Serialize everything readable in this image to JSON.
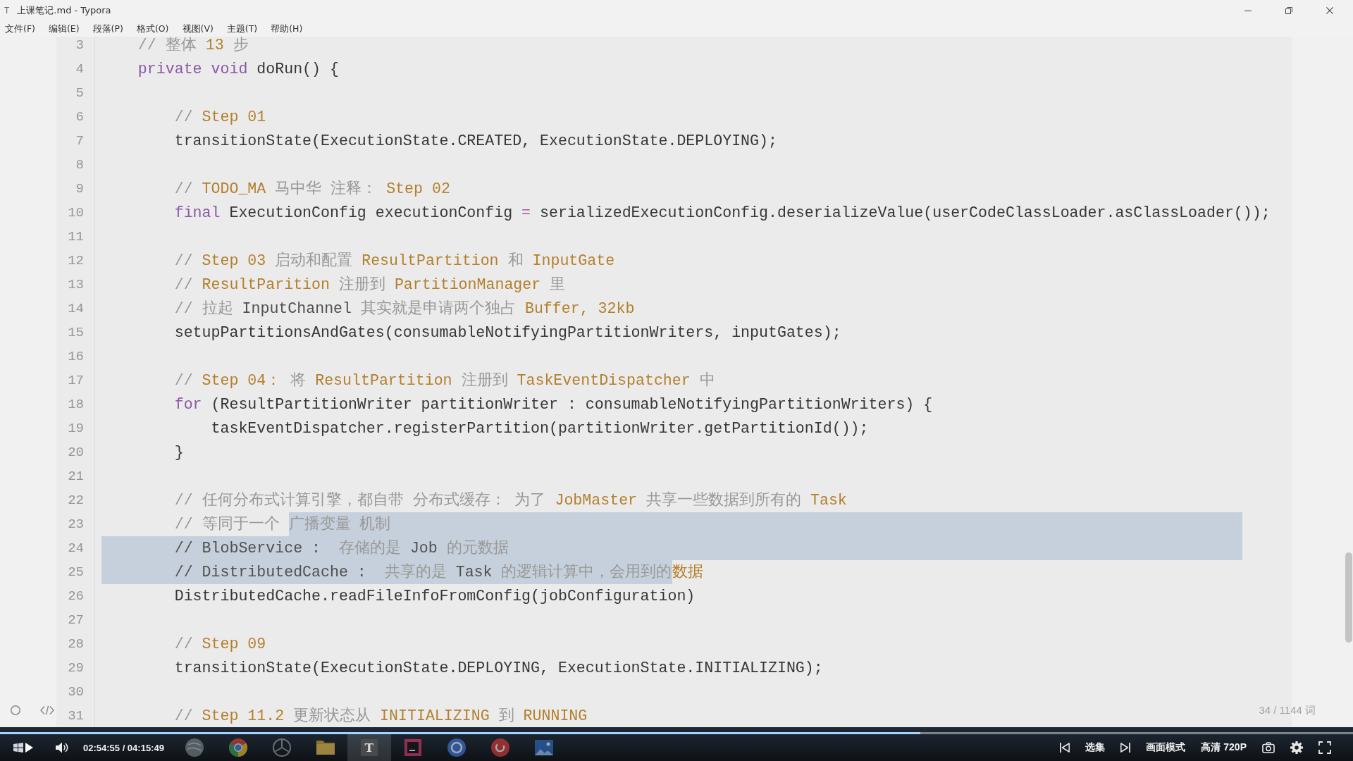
{
  "window": {
    "app_letter": "T",
    "title": "上课笔记.md - Typora"
  },
  "menu": [
    "文件(F)",
    "编辑(E)",
    "段落(P)",
    "格式(O)",
    "视图(V)",
    "主题(T)",
    "帮助(H)"
  ],
  "editor": {
    "lines": [
      {
        "number": "3",
        "eol_selected": false,
        "segments": [
          {
            "selected": false,
            "tokens": [
              {
                "text": "    // 整体 ",
                "kind": "comment"
              },
              {
                "text": "13",
                "kind": "term"
              },
              {
                "text": " 步",
                "kind": "comment"
              }
            ]
          }
        ]
      },
      {
        "number": "4",
        "eol_selected": false,
        "segments": [
          {
            "selected": false,
            "tokens": [
              {
                "text": "    private void",
                "kind": "keyword"
              },
              {
                "text": " doRun() {",
                "kind": "plain"
              }
            ]
          }
        ]
      },
      {
        "number": "5",
        "eol_selected": false
      },
      {
        "number": "6",
        "eol_selected": false,
        "segments": [
          {
            "selected": false,
            "tokens": [
              {
                "text": "        // ",
                "kind": "comment"
              },
              {
                "text": "Step 01",
                "kind": "term"
              }
            ]
          }
        ]
      },
      {
        "number": "7",
        "eol_selected": false,
        "segments": [
          {
            "selected": false,
            "tokens": [
              {
                "text": "        transitionState(ExecutionState.CREATED, ExecutionState.DEPLOYING);",
                "kind": "plain"
              }
            ]
          }
        ]
      },
      {
        "number": "8",
        "eol_selected": false
      },
      {
        "number": "9",
        "eol_selected": false,
        "segments": [
          {
            "selected": false,
            "tokens": [
              {
                "text": "        // ",
                "kind": "comment"
              },
              {
                "text": "TODO_MA",
                "kind": "term"
              },
              {
                "text": " 马中华 注释： ",
                "kind": "comment"
              },
              {
                "text": "Step 02",
                "kind": "term"
              }
            ]
          }
        ]
      },
      {
        "number": "10",
        "eol_selected": false,
        "segments": [
          {
            "selected": false,
            "tokens": [
              {
                "text": "        final",
                "kind": "keyword"
              },
              {
                "text": " ExecutionConfig executionConfig ",
                "kind": "plain"
              },
              {
                "text": "=",
                "kind": "operator"
              },
              {
                "text": " serializedExecutionConfig.deserializeValue(userCodeClassLoader.asClassLoader());",
                "kind": "plain"
              }
            ]
          }
        ]
      },
      {
        "number": "11",
        "eol_selected": false
      },
      {
        "number": "12",
        "eol_selected": false,
        "segments": [
          {
            "selected": false,
            "tokens": [
              {
                "text": "        // ",
                "kind": "comment"
              },
              {
                "text": "Step 03",
                "kind": "term"
              },
              {
                "text": " 启动和配置 ",
                "kind": "comment"
              },
              {
                "text": "ResultPartition",
                "kind": "term"
              },
              {
                "text": " 和 ",
                "kind": "comment"
              },
              {
                "text": "InputGate",
                "kind": "term"
              }
            ]
          }
        ]
      },
      {
        "number": "13",
        "eol_selected": false,
        "segments": [
          {
            "selected": false,
            "tokens": [
              {
                "text": "        // ",
                "kind": "comment"
              },
              {
                "text": "ResultParition",
                "kind": "term"
              },
              {
                "text": " 注册到 ",
                "kind": "comment"
              },
              {
                "text": "PartitionManager",
                "kind": "term"
              },
              {
                "text": " 里",
                "kind": "comment"
              }
            ]
          }
        ]
      },
      {
        "number": "14",
        "eol_selected": false,
        "segments": [
          {
            "selected": false,
            "tokens": [
              {
                "text": "        // 拉起 ",
                "kind": "comment"
              },
              {
                "text": "InputChannel",
                "kind": "muted"
              },
              {
                "text": " 其实就是申请两个独占 ",
                "kind": "comment"
              },
              {
                "text": "Buffer, 32kb",
                "kind": "term"
              }
            ]
          }
        ]
      },
      {
        "number": "15",
        "eol_selected": false,
        "segments": [
          {
            "selected": false,
            "tokens": [
              {
                "text": "        setupPartitionsAndGates(consumableNotifyingPartitionWriters, inputGates);",
                "kind": "plain"
              }
            ]
          }
        ]
      },
      {
        "number": "16",
        "eol_selected": false
      },
      {
        "number": "17",
        "eol_selected": false,
        "segments": [
          {
            "selected": false,
            "tokens": [
              {
                "text": "        // ",
                "kind": "comment"
              },
              {
                "text": "Step 04：",
                "kind": "term"
              },
              {
                "text": " 将 ",
                "kind": "comment"
              },
              {
                "text": "ResultPartition",
                "kind": "term"
              },
              {
                "text": " 注册到 ",
                "kind": "comment"
              },
              {
                "text": "TaskEventDispatcher",
                "kind": "term"
              },
              {
                "text": " 中",
                "kind": "comment"
              }
            ]
          }
        ]
      },
      {
        "number": "18",
        "eol_selected": false,
        "segments": [
          {
            "selected": false,
            "tokens": [
              {
                "text": "        for",
                "kind": "keyword"
              },
              {
                "text": " (ResultPartitionWriter partitionWriter : consumableNotifyingPartitionWriters) {",
                "kind": "plain"
              }
            ]
          }
        ]
      },
      {
        "number": "19",
        "eol_selected": false,
        "segments": [
          {
            "selected": false,
            "tokens": [
              {
                "text": "            taskEventDispatcher.registerPartition(partitionWriter.getPartitionId());",
                "kind": "plain"
              }
            ]
          }
        ]
      },
      {
        "number": "20",
        "eol_selected": false,
        "segments": [
          {
            "selected": false,
            "tokens": [
              {
                "text": "        }",
                "kind": "plain"
              }
            ]
          }
        ]
      },
      {
        "number": "21",
        "eol_selected": false
      },
      {
        "number": "22",
        "eol_selected": false,
        "segments": [
          {
            "selected": false,
            "tokens": [
              {
                "text": "        // 任何分布式计算引擎，都自带 分布式缓存： 为了 ",
                "kind": "comment"
              },
              {
                "text": "JobMaster",
                "kind": "term"
              },
              {
                "text": " 共享一些数据到所有的 ",
                "kind": "comment"
              },
              {
                "text": "Task",
                "kind": "term"
              }
            ]
          }
        ]
      },
      {
        "number": "23",
        "eol_selected": true,
        "segments": [
          {
            "selected": false,
            "tokens": [
              {
                "text": "        // 等同于一个 ",
                "kind": "comment"
              }
            ]
          },
          {
            "selected": true,
            "tokens": [
              {
                "text": "广播变量 机制",
                "kind": "comment"
              }
            ]
          }
        ]
      },
      {
        "number": "24",
        "eol_selected": true,
        "segments": [
          {
            "selected": true,
            "tokens": [
              {
                "text": "        // BlobService :",
                "kind": "muted"
              },
              {
                "text": "  存储的是 ",
                "kind": "comment"
              },
              {
                "text": "Job",
                "kind": "muted"
              },
              {
                "text": " 的元数据",
                "kind": "comment"
              }
            ]
          }
        ]
      },
      {
        "number": "25",
        "eol_selected": false,
        "segments": [
          {
            "selected": true,
            "tokens": [
              {
                "text": "        // DistributedCache :",
                "kind": "muted"
              },
              {
                "text": "  共享的是 ",
                "kind": "comment"
              },
              {
                "text": "Task",
                "kind": "muted"
              },
              {
                "text": " 的逻辑计算中，会用到的",
                "kind": "comment"
              }
            ]
          },
          {
            "selected": false,
            "tokens": [
              {
                "text": "数据",
                "kind": "term"
              }
            ]
          }
        ]
      },
      {
        "number": "26",
        "eol_selected": false,
        "segments": [
          {
            "selected": false,
            "tokens": [
              {
                "text": "        DistributedCache.readFileInfoFromConfig(jobConfiguration)",
                "kind": "plain"
              }
            ]
          }
        ]
      },
      {
        "number": "27",
        "eol_selected": false
      },
      {
        "number": "28",
        "eol_selected": false,
        "segments": [
          {
            "selected": false,
            "tokens": [
              {
                "text": "        // ",
                "kind": "comment"
              },
              {
                "text": "Step 09",
                "kind": "term"
              }
            ]
          }
        ]
      },
      {
        "number": "29",
        "eol_selected": false,
        "segments": [
          {
            "selected": false,
            "tokens": [
              {
                "text": "        transitionState(ExecutionState.DEPLOYING, ExecutionState.INITIALIZING);",
                "kind": "plain"
              }
            ]
          }
        ]
      },
      {
        "number": "30",
        "eol_selected": false
      },
      {
        "number": "31",
        "eol_selected": false,
        "segments": [
          {
            "selected": false,
            "tokens": [
              {
                "text": "        // ",
                "kind": "comment"
              },
              {
                "text": "Step 11.2",
                "kind": "term"
              },
              {
                "text": " 更新状态从 ",
                "kind": "comment"
              },
              {
                "text": "INITIALIZING",
                "kind": "term"
              },
              {
                "text": " 到 ",
                "kind": "comment"
              },
              {
                "text": "RUNNING",
                "kind": "term"
              }
            ]
          }
        ]
      }
    ]
  },
  "footer": {
    "word_count": "34 / 1144 词"
  },
  "player": {
    "progress": {
      "level": 0.68
    },
    "time": "02:54:55 / 04:15:49",
    "taskbar": [
      {
        "kind": "sphere",
        "active": false
      },
      {
        "kind": "wheel",
        "active": false
      },
      {
        "kind": "emblem",
        "active": false
      },
      {
        "kind": "folder",
        "active": false
      },
      {
        "kind": "letter",
        "letter": "T",
        "active": true
      },
      {
        "kind": "tile",
        "active": false
      },
      {
        "kind": "disc",
        "active": false
      },
      {
        "kind": "swirl",
        "active": false
      },
      {
        "kind": "picture",
        "active": false
      }
    ],
    "episodes": "选集",
    "picture_mode": "画面模式",
    "quality": "高清 720P"
  }
}
